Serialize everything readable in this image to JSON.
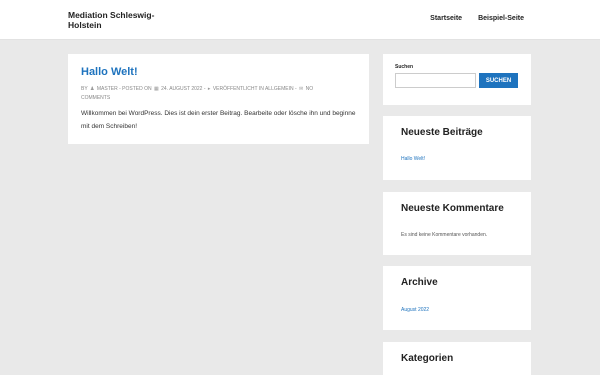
{
  "header": {
    "site_title": "Mediation Schleswig-Holstein",
    "nav": [
      "Startseite",
      "Beispiel-Seite"
    ]
  },
  "post": {
    "title": "Hallo Welt!",
    "meta": {
      "by": "BY",
      "author": "MASTER",
      "posted_on": "POSTED ON",
      "date": "24. AUGUST 2022",
      "category": "VERÖFFENTLICHT IN ALLGEMEIN",
      "comments": "NO COMMENTS"
    },
    "body": "Willkommen bei WordPress. Dies ist dein erster Beitrag. Bearbeite oder lösche ihn und beginne mit dem Schreiben!"
  },
  "sidebar": {
    "search": {
      "label": "Suchen",
      "button": "SUCHEN",
      "value": ""
    },
    "recent_posts": {
      "title": "Neueste Beiträge",
      "items": [
        "Hallo Welt!"
      ]
    },
    "recent_comments": {
      "title": "Neueste Kommentare",
      "empty": "Es sind keine Kommentare vorhanden."
    },
    "archive": {
      "title": "Archive",
      "items": [
        "August 2022"
      ]
    },
    "categories": {
      "title": "Kategorien"
    }
  },
  "colors": {
    "accent": "#1e73be",
    "background": "#e9e9e9"
  }
}
